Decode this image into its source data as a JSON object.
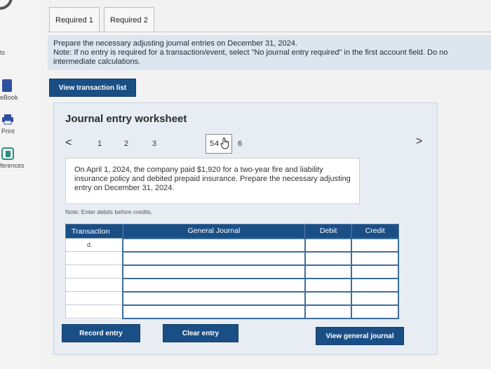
{
  "sidebar": {
    "items": [
      {
        "label": "ts"
      },
      {
        "label": "eBook"
      },
      {
        "label": "Print"
      },
      {
        "label": "ferences"
      }
    ]
  },
  "tabs": [
    {
      "label": "Required 1"
    },
    {
      "label": "Required 2"
    }
  ],
  "instructions": {
    "line1": "Prepare the necessary adjusting journal entries on December 31, 2024.",
    "line2": "Note: If no entry is required for a transaction/event, select \"No journal entry required\" in the first account field. Do no",
    "line3": "intermediate calculations."
  },
  "buttons": {
    "view_transaction_list": "View transaction list",
    "record_entry": "Record entry",
    "clear_entry": "Clear entry",
    "view_general_journal": "View general journal"
  },
  "worksheet": {
    "title": "Journal entry worksheet",
    "pager": {
      "prev": "<",
      "next": ">",
      "pages": [
        "1",
        "2",
        "3",
        "4",
        "5",
        "6"
      ],
      "active": "4"
    },
    "scenario": "On April 1, 2024, the company paid $1,920 for a two-year fire and liability insurance policy and debited prepaid insurance. Prepare the necessary adjusting entry on December 31, 2024.",
    "note": "Note: Enter debits before credits.",
    "table": {
      "headers": [
        "Transaction",
        "General Journal",
        "Debit",
        "Credit"
      ],
      "rows": [
        {
          "transaction": "d."
        },
        {
          "transaction": ""
        },
        {
          "transaction": ""
        },
        {
          "transaction": ""
        },
        {
          "transaction": ""
        },
        {
          "transaction": ""
        }
      ]
    }
  }
}
